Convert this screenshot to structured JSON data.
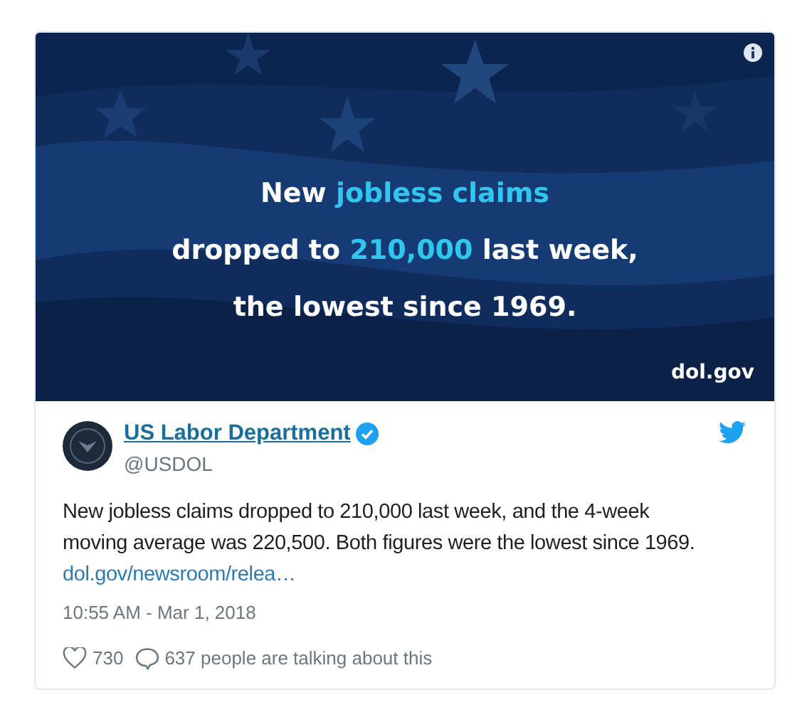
{
  "image_card": {
    "kind": "picture",
    "headline": [
      [
        {
          "text": "New ",
          "highlight": false
        },
        {
          "text": "jobless claims",
          "highlight": true
        }
      ],
      [
        {
          "text": "dropped to ",
          "highlight": false
        },
        {
          "text": "210,000",
          "highlight": true
        },
        {
          "text": " last week,",
          "highlight": false
        }
      ],
      [
        {
          "text": "the lowest since 1969.",
          "highlight": false
        }
      ]
    ],
    "source": "dol.gov"
  },
  "tweet": {
    "author": "US Labor Department",
    "verified": true,
    "handle": "@USDOL",
    "text": "New jobless claims dropped to 210,000 last week, and the 4-week moving average was 220,500. Both figures were the lowest since 1969.",
    "link": "dol.gov/newsroom/relea…",
    "timestamp": "10:55 AM - Mar 1, 2018",
    "likes": "730",
    "talking": "637 people are talking about this"
  }
}
